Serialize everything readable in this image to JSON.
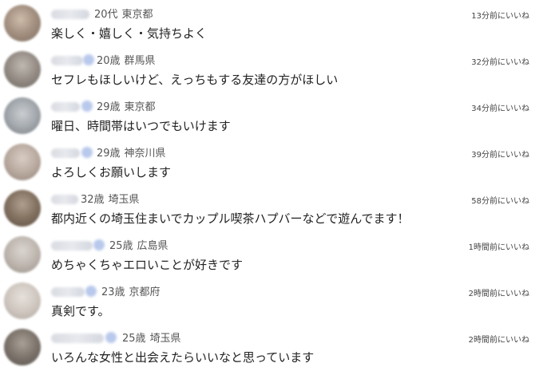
{
  "list": {
    "items": [
      {
        "age": "20代",
        "prefecture": "東京都",
        "time": "13分前にいいね",
        "message": "楽しく・嬉しく・気持ちよく",
        "avatar_icon": "user-avatar"
      },
      {
        "age": "20歳",
        "prefecture": "群馬県",
        "time": "32分前にいいね",
        "message": "セフレもほしいけど、えっちもする友達の方がほしい",
        "avatar_icon": "user-avatar"
      },
      {
        "age": "29歳",
        "prefecture": "東京都",
        "time": "34分前にいいね",
        "message": "曜日、時間帯はいつでもいけます",
        "avatar_icon": "user-avatar"
      },
      {
        "age": "29歳",
        "prefecture": "神奈川県",
        "time": "39分前にいいね",
        "message": "よろしくお願いします",
        "avatar_icon": "user-avatar"
      },
      {
        "age": "32歳",
        "prefecture": "埼玉県",
        "time": "58分前にいいね",
        "message": "都内近くの埼玉住まいでカップル喫茶ハプバーなどで遊んでます！",
        "avatar_icon": "user-avatar"
      },
      {
        "age": "25歳",
        "prefecture": "広島県",
        "time": "1時間前にいいね",
        "message": "めちゃくちゃエロいことが好きです",
        "avatar_icon": "user-avatar"
      },
      {
        "age": "23歳",
        "prefecture": "京都府",
        "time": "2時間前にいいね",
        "message": "真剣です。",
        "avatar_icon": "user-avatar"
      },
      {
        "age": "25歳",
        "prefecture": "埼玉県",
        "time": "2時間前にいいね",
        "message": "いろんな女性と出会えたらいいなと思っています",
        "avatar_icon": "user-avatar"
      }
    ]
  }
}
